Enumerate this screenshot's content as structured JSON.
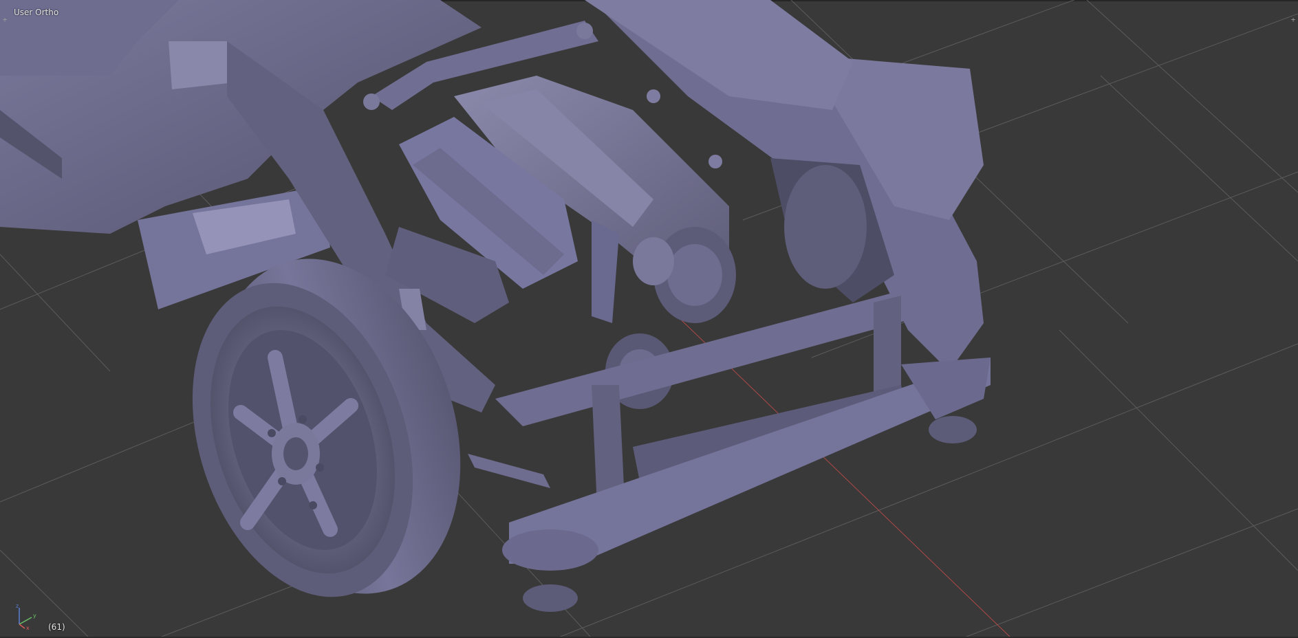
{
  "viewport": {
    "view_label": "User Ortho",
    "frame_label": "(61)",
    "corner_left_icon": "plus-icon",
    "corner_right_icon": "plus-icon",
    "corner_glyph": "+",
    "gizmo": {
      "icon": "axis-gizmo-icon",
      "x_label": "x",
      "y_label": "y",
      "z_label": "z"
    },
    "colors": {
      "background": "#393939",
      "grid_line": "#5a5a5a",
      "x_axis": "#c05050",
      "model_base": "#6c6b8c",
      "model_dark": "#4a4962",
      "model_light": "#8e8db0"
    }
  }
}
